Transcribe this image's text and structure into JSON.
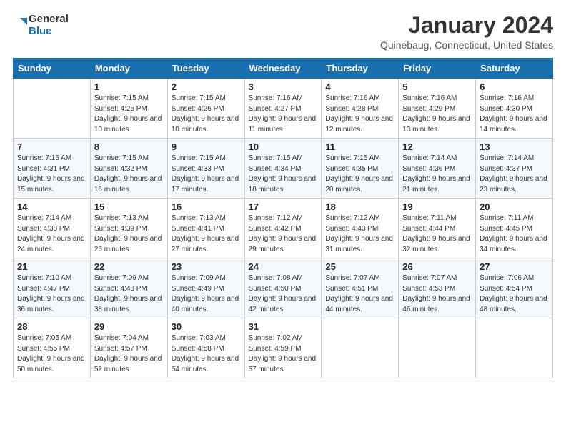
{
  "header": {
    "logo_line1": "General",
    "logo_line2": "Blue",
    "month": "January 2024",
    "location": "Quinebaug, Connecticut, United States"
  },
  "weekdays": [
    "Sunday",
    "Monday",
    "Tuesday",
    "Wednesday",
    "Thursday",
    "Friday",
    "Saturday"
  ],
  "weeks": [
    [
      {
        "day": "",
        "sunrise": "",
        "sunset": "",
        "daylight": ""
      },
      {
        "day": "1",
        "sunrise": "Sunrise: 7:15 AM",
        "sunset": "Sunset: 4:25 PM",
        "daylight": "Daylight: 9 hours and 10 minutes."
      },
      {
        "day": "2",
        "sunrise": "Sunrise: 7:15 AM",
        "sunset": "Sunset: 4:26 PM",
        "daylight": "Daylight: 9 hours and 10 minutes."
      },
      {
        "day": "3",
        "sunrise": "Sunrise: 7:16 AM",
        "sunset": "Sunset: 4:27 PM",
        "daylight": "Daylight: 9 hours and 11 minutes."
      },
      {
        "day": "4",
        "sunrise": "Sunrise: 7:16 AM",
        "sunset": "Sunset: 4:28 PM",
        "daylight": "Daylight: 9 hours and 12 minutes."
      },
      {
        "day": "5",
        "sunrise": "Sunrise: 7:16 AM",
        "sunset": "Sunset: 4:29 PM",
        "daylight": "Daylight: 9 hours and 13 minutes."
      },
      {
        "day": "6",
        "sunrise": "Sunrise: 7:16 AM",
        "sunset": "Sunset: 4:30 PM",
        "daylight": "Daylight: 9 hours and 14 minutes."
      }
    ],
    [
      {
        "day": "7",
        "sunrise": "Sunrise: 7:15 AM",
        "sunset": "Sunset: 4:31 PM",
        "daylight": "Daylight: 9 hours and 15 minutes."
      },
      {
        "day": "8",
        "sunrise": "Sunrise: 7:15 AM",
        "sunset": "Sunset: 4:32 PM",
        "daylight": "Daylight: 9 hours and 16 minutes."
      },
      {
        "day": "9",
        "sunrise": "Sunrise: 7:15 AM",
        "sunset": "Sunset: 4:33 PM",
        "daylight": "Daylight: 9 hours and 17 minutes."
      },
      {
        "day": "10",
        "sunrise": "Sunrise: 7:15 AM",
        "sunset": "Sunset: 4:34 PM",
        "daylight": "Daylight: 9 hours and 18 minutes."
      },
      {
        "day": "11",
        "sunrise": "Sunrise: 7:15 AM",
        "sunset": "Sunset: 4:35 PM",
        "daylight": "Daylight: 9 hours and 20 minutes."
      },
      {
        "day": "12",
        "sunrise": "Sunrise: 7:14 AM",
        "sunset": "Sunset: 4:36 PM",
        "daylight": "Daylight: 9 hours and 21 minutes."
      },
      {
        "day": "13",
        "sunrise": "Sunrise: 7:14 AM",
        "sunset": "Sunset: 4:37 PM",
        "daylight": "Daylight: 9 hours and 23 minutes."
      }
    ],
    [
      {
        "day": "14",
        "sunrise": "Sunrise: 7:14 AM",
        "sunset": "Sunset: 4:38 PM",
        "daylight": "Daylight: 9 hours and 24 minutes."
      },
      {
        "day": "15",
        "sunrise": "Sunrise: 7:13 AM",
        "sunset": "Sunset: 4:39 PM",
        "daylight": "Daylight: 9 hours and 26 minutes."
      },
      {
        "day": "16",
        "sunrise": "Sunrise: 7:13 AM",
        "sunset": "Sunset: 4:41 PM",
        "daylight": "Daylight: 9 hours and 27 minutes."
      },
      {
        "day": "17",
        "sunrise": "Sunrise: 7:12 AM",
        "sunset": "Sunset: 4:42 PM",
        "daylight": "Daylight: 9 hours and 29 minutes."
      },
      {
        "day": "18",
        "sunrise": "Sunrise: 7:12 AM",
        "sunset": "Sunset: 4:43 PM",
        "daylight": "Daylight: 9 hours and 31 minutes."
      },
      {
        "day": "19",
        "sunrise": "Sunrise: 7:11 AM",
        "sunset": "Sunset: 4:44 PM",
        "daylight": "Daylight: 9 hours and 32 minutes."
      },
      {
        "day": "20",
        "sunrise": "Sunrise: 7:11 AM",
        "sunset": "Sunset: 4:45 PM",
        "daylight": "Daylight: 9 hours and 34 minutes."
      }
    ],
    [
      {
        "day": "21",
        "sunrise": "Sunrise: 7:10 AM",
        "sunset": "Sunset: 4:47 PM",
        "daylight": "Daylight: 9 hours and 36 minutes."
      },
      {
        "day": "22",
        "sunrise": "Sunrise: 7:09 AM",
        "sunset": "Sunset: 4:48 PM",
        "daylight": "Daylight: 9 hours and 38 minutes."
      },
      {
        "day": "23",
        "sunrise": "Sunrise: 7:09 AM",
        "sunset": "Sunset: 4:49 PM",
        "daylight": "Daylight: 9 hours and 40 minutes."
      },
      {
        "day": "24",
        "sunrise": "Sunrise: 7:08 AM",
        "sunset": "Sunset: 4:50 PM",
        "daylight": "Daylight: 9 hours and 42 minutes."
      },
      {
        "day": "25",
        "sunrise": "Sunrise: 7:07 AM",
        "sunset": "Sunset: 4:51 PM",
        "daylight": "Daylight: 9 hours and 44 minutes."
      },
      {
        "day": "26",
        "sunrise": "Sunrise: 7:07 AM",
        "sunset": "Sunset: 4:53 PM",
        "daylight": "Daylight: 9 hours and 46 minutes."
      },
      {
        "day": "27",
        "sunrise": "Sunrise: 7:06 AM",
        "sunset": "Sunset: 4:54 PM",
        "daylight": "Daylight: 9 hours and 48 minutes."
      }
    ],
    [
      {
        "day": "28",
        "sunrise": "Sunrise: 7:05 AM",
        "sunset": "Sunset: 4:55 PM",
        "daylight": "Daylight: 9 hours and 50 minutes."
      },
      {
        "day": "29",
        "sunrise": "Sunrise: 7:04 AM",
        "sunset": "Sunset: 4:57 PM",
        "daylight": "Daylight: 9 hours and 52 minutes."
      },
      {
        "day": "30",
        "sunrise": "Sunrise: 7:03 AM",
        "sunset": "Sunset: 4:58 PM",
        "daylight": "Daylight: 9 hours and 54 minutes."
      },
      {
        "day": "31",
        "sunrise": "Sunrise: 7:02 AM",
        "sunset": "Sunset: 4:59 PM",
        "daylight": "Daylight: 9 hours and 57 minutes."
      },
      {
        "day": "",
        "sunrise": "",
        "sunset": "",
        "daylight": ""
      },
      {
        "day": "",
        "sunrise": "",
        "sunset": "",
        "daylight": ""
      },
      {
        "day": "",
        "sunrise": "",
        "sunset": "",
        "daylight": ""
      }
    ]
  ]
}
